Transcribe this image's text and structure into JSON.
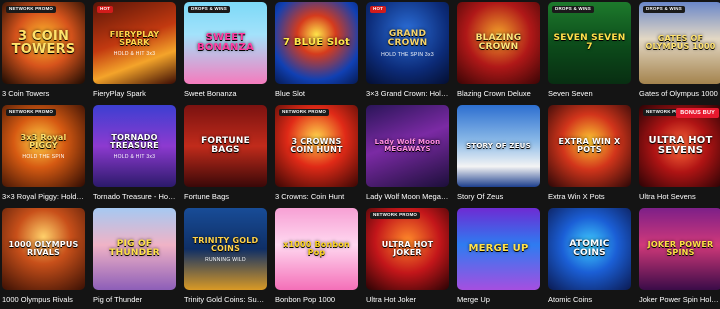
{
  "rows": [
    [
      {
        "title": "3 Coin Towers",
        "art": "3 COIN TOWERS",
        "badge": "NETWORK PROMO"
      },
      {
        "title": "FieryPlay Spark",
        "art": "FIERYPLAY SPARK",
        "sub": "HOLD & HIT 3x3",
        "badge": "HOT"
      },
      {
        "title": "Sweet Bonanza",
        "art": "SWEET BONANZA",
        "badge": "DROPS & WINS"
      },
      {
        "title": "Blue Slot",
        "art": "7 BLUE Slot"
      },
      {
        "title": "3×3 Grand Crown: Hold t…",
        "art": "GRAND CROWN",
        "sub": "HOLD THE SPIN 3x3",
        "badge": "HOT"
      },
      {
        "title": "Blazing Crown Deluxe",
        "art": "BLAZING CROWN"
      },
      {
        "title": "Seven Seven",
        "art": "SEVEN SEVEN 7",
        "badge": "DROPS & WINS"
      },
      {
        "title": "Gates of Olympus 1000",
        "art": "GATES OF OLYMPUS 1000",
        "badge": "DROPS & WINS"
      }
    ],
    [
      {
        "title": "3×3 Royal Piggy: Hold Th…",
        "art": "3x3 Royal PIGGY",
        "sub": "HOLD THE SPIN",
        "badge": "NETWORK PROMO"
      },
      {
        "title": "Tornado Treasure - Hold …",
        "art": "TORNADO TREASURE",
        "sub": "HOLD & HIT 3x3"
      },
      {
        "title": "Fortune Bags",
        "art": "FORTUNE BAGS"
      },
      {
        "title": "3 Crowns: Coin Hunt",
        "art": "3 CROWNS COIN HUNT",
        "badge": "NETWORK PROMO"
      },
      {
        "title": "Lady Wolf Moon Megaways",
        "art": "Lady Wolf Moon MEGAWAYS"
      },
      {
        "title": "Story Of Zeus",
        "art": "STORY OF ZEUS"
      },
      {
        "title": "Extra Win X Pots",
        "art": "EXTRA WIN X POTS"
      },
      {
        "title": "Ultra Hot Sevens",
        "art": "ULTRA HOT SEVENS",
        "badge": "NETWORK PROMO",
        "badge2": "BONUS BUY"
      }
    ],
    [
      {
        "title": "1000 Olympus Rivals",
        "art": "1000 OLYMPUS RIVALS"
      },
      {
        "title": "Pig of Thunder",
        "art": "PIG OF THUNDER"
      },
      {
        "title": "Trinity Gold Coins: Summ…",
        "art": "TRINITY GOLD COINS",
        "sub": "RUNNING WILD"
      },
      {
        "title": "Bonbon Pop 1000",
        "art": "x1000 Bonbon Pop"
      },
      {
        "title": "Ultra Hot Joker",
        "art": "ULTRA HOT JOKER",
        "badge": "NETWORK PROMO"
      },
      {
        "title": "Merge Up",
        "art": "MERGE UP"
      },
      {
        "title": "Atomic Coins",
        "art": "ATOMIC COINS"
      },
      {
        "title": "Joker Power Spin Hold an…",
        "art": "JOKER POWER SPINS"
      }
    ]
  ],
  "theme": {
    "background": "#141414",
    "text": "#ffffff"
  }
}
